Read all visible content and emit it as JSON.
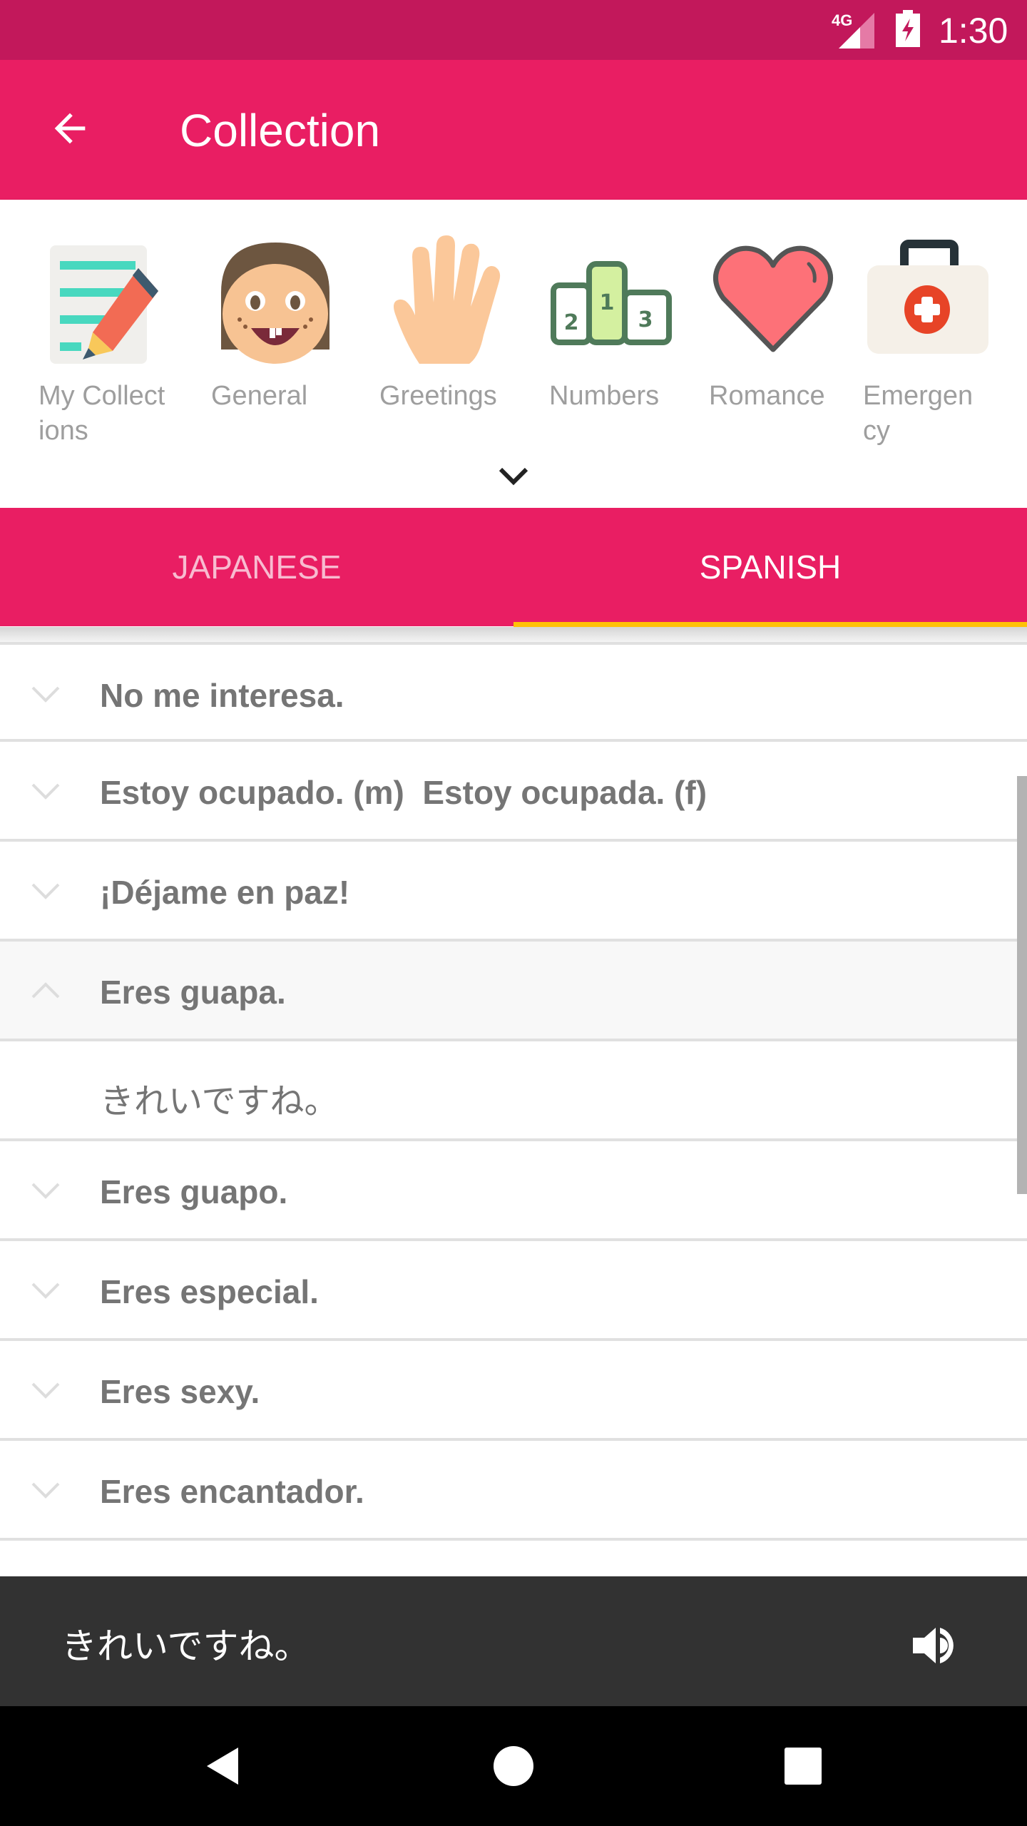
{
  "status_bar": {
    "network": "4G",
    "time": "1:30"
  },
  "app_bar": {
    "title": "Collection",
    "back_icon": "arrow-back-icon"
  },
  "categories": [
    {
      "label": "My Collect\nions",
      "icon": "notepad-pencil-icon"
    },
    {
      "label": "General",
      "icon": "face-icon"
    },
    {
      "label": "Greetings",
      "icon": "hand-wave-icon"
    },
    {
      "label": "Numbers",
      "icon": "podium-icon"
    },
    {
      "label": "Romance",
      "icon": "heart-icon"
    },
    {
      "label": "Emergen\ncy",
      "icon": "first-aid-kit-icon"
    }
  ],
  "tabs": [
    {
      "label": "JAPANESE",
      "selected": false
    },
    {
      "label": "SPANISH",
      "selected": true
    }
  ],
  "colors": {
    "status_bar": "#c2185b",
    "primary": "#e91e63",
    "tab_indicator": "#ffc107",
    "player_bg": "#323232"
  },
  "phrases": [
    {
      "text": "No me interesa.",
      "expanded": false
    },
    {
      "text": "Estoy ocupado. (m)  Estoy ocupada. (f)",
      "expanded": false
    },
    {
      "text": "¡Déjame en paz!",
      "expanded": false
    },
    {
      "text": "Eres guapa.",
      "expanded": true,
      "translation": "きれいですね。"
    },
    {
      "text": "Eres guapo.",
      "expanded": false
    },
    {
      "text": "Eres especial.",
      "expanded": false
    },
    {
      "text": "Eres sexy.",
      "expanded": false
    },
    {
      "text": "Eres encantador.",
      "expanded": false
    }
  ],
  "player": {
    "text": "きれいですね。",
    "icon": "volume-up-icon"
  },
  "nav": {
    "back": "nav-back-icon",
    "home": "nav-home-icon",
    "recents": "nav-recents-icon"
  }
}
